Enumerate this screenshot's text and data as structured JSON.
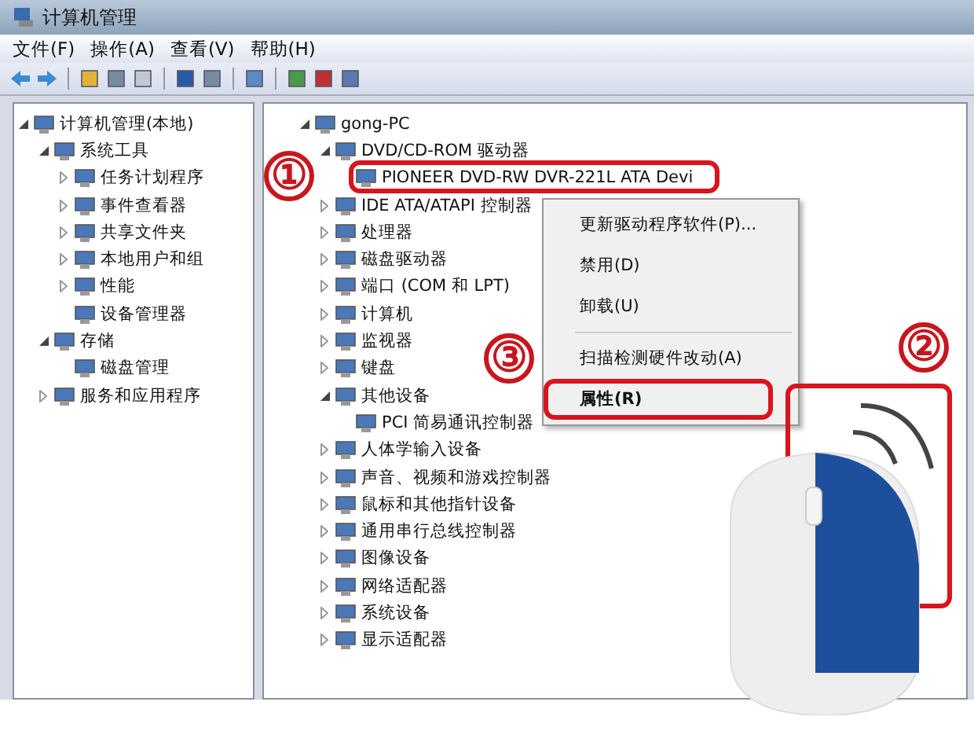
{
  "window": {
    "title": "计算机管理"
  },
  "menu": [
    "文件(F)",
    "操作(A)",
    "查看(V)",
    "帮助(H)"
  ],
  "left_tree": [
    {
      "label": "计算机管理(本地)",
      "expanded": true,
      "children": [
        {
          "label": "系统工具",
          "expanded": true,
          "children": [
            {
              "label": "任务计划程序",
              "expanded": false
            },
            {
              "label": "事件查看器",
              "expanded": false
            },
            {
              "label": "共享文件夹",
              "expanded": false
            },
            {
              "label": "本地用户和组",
              "expanded": false
            },
            {
              "label": "性能",
              "expanded": false
            },
            {
              "label": "设备管理器"
            }
          ]
        },
        {
          "label": "存储",
          "expanded": true,
          "children": [
            {
              "label": "磁盘管理"
            }
          ]
        },
        {
          "label": "服务和应用程序",
          "expanded": false
        }
      ]
    }
  ],
  "device_tree": [
    {
      "label": "gong-PC",
      "expanded": true,
      "children": [
        {
          "label": "DVD/CD-ROM 驱动器",
          "expanded": true,
          "children": [
            {
              "label": "PIONEER DVD-RW  DVR-221L ATA Devi"
            }
          ]
        },
        {
          "label": "IDE ATA/ATAPI 控制器",
          "expanded": false
        },
        {
          "label": "处理器",
          "expanded": false
        },
        {
          "label": "磁盘驱动器",
          "expanded": false
        },
        {
          "label": "端口 (COM 和 LPT)",
          "expanded": false
        },
        {
          "label": "计算机",
          "expanded": false
        },
        {
          "label": "监视器",
          "expanded": false
        },
        {
          "label": "键盘",
          "expanded": false
        },
        {
          "label": "其他设备",
          "expanded": true,
          "children": [
            {
              "label": "PCI 简易通讯控制器"
            }
          ]
        },
        {
          "label": "人体学输入设备",
          "expanded": false
        },
        {
          "label": "声音、视频和游戏控制器",
          "expanded": false
        },
        {
          "label": "鼠标和其他指针设备",
          "expanded": false
        },
        {
          "label": "通用串行总线控制器",
          "expanded": false
        },
        {
          "label": "图像设备",
          "expanded": false
        },
        {
          "label": "网络适配器",
          "expanded": false
        },
        {
          "label": "系统设备",
          "expanded": false
        },
        {
          "label": "显示适配器",
          "expanded": false
        }
      ]
    }
  ],
  "context_menu": [
    {
      "label": "更新驱动程序软件(P)...",
      "kind": "item"
    },
    {
      "label": "禁用(D)",
      "kind": "item"
    },
    {
      "label": "卸载(U)",
      "kind": "item"
    },
    {
      "kind": "separator"
    },
    {
      "label": "扫描检测硬件改动(A)",
      "kind": "item"
    },
    {
      "label": "属性(R)",
      "kind": "default"
    }
  ],
  "annotations": [
    "①",
    "②",
    "③"
  ]
}
